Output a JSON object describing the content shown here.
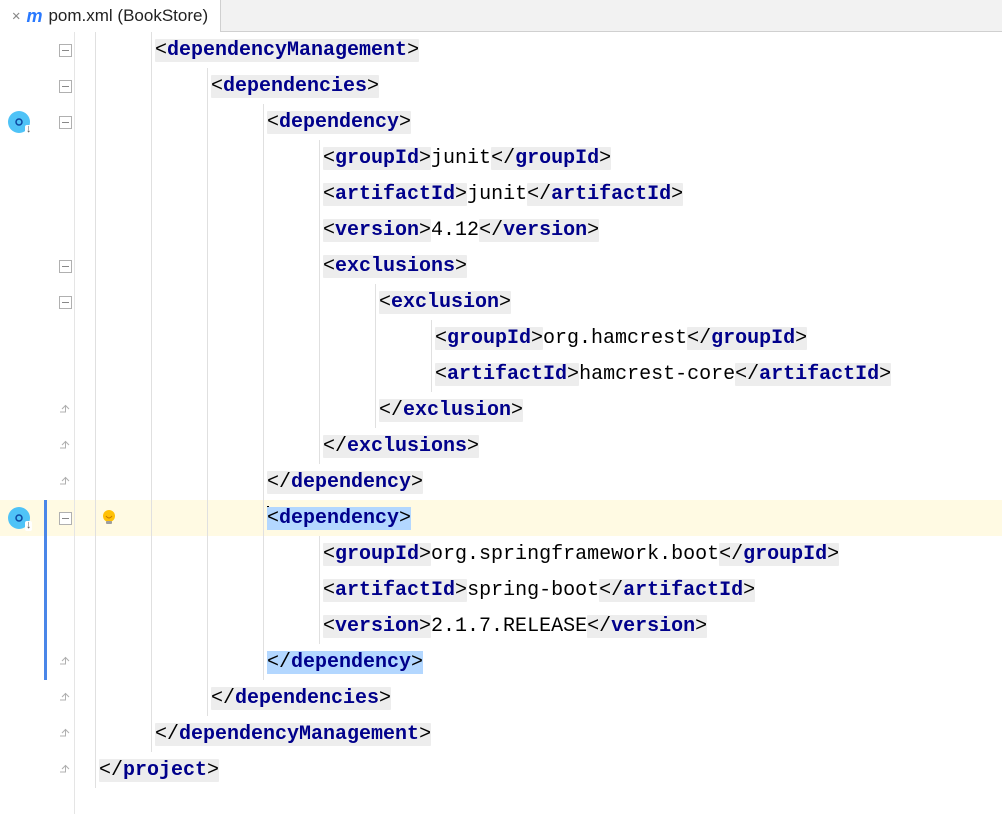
{
  "tab": {
    "label": "pom.xml (BookStore)"
  },
  "lines": [
    {
      "indent": 1,
      "type": "open",
      "bg": "grey",
      "tag": "dependencyManagement",
      "fold": "minus"
    },
    {
      "indent": 2,
      "type": "open",
      "bg": "grey",
      "tag": "dependencies",
      "fold": "minus"
    },
    {
      "indent": 3,
      "type": "open",
      "bg": "grey",
      "tag": "dependency",
      "fold": "minus",
      "override": true
    },
    {
      "indent": 4,
      "type": "leaf",
      "bg": "grey",
      "tag": "groupId",
      "text": "junit"
    },
    {
      "indent": 4,
      "type": "leaf",
      "bg": "grey",
      "tag": "artifactId",
      "text": "junit"
    },
    {
      "indent": 4,
      "type": "leaf",
      "bg": "grey",
      "tag": "version",
      "text": "4.12"
    },
    {
      "indent": 4,
      "type": "open",
      "bg": "grey",
      "tag": "exclusions",
      "fold": "minus"
    },
    {
      "indent": 5,
      "type": "open",
      "bg": "grey",
      "tag": "exclusion",
      "fold": "minus"
    },
    {
      "indent": 6,
      "type": "leaf",
      "bg": "grey",
      "tag": "groupId",
      "text": "org.hamcrest"
    },
    {
      "indent": 6,
      "type": "leaf",
      "bg": "grey",
      "tag": "artifactId",
      "text": "hamcrest-core"
    },
    {
      "indent": 5,
      "type": "close",
      "bg": "grey",
      "tag": "exclusion",
      "fold": "up"
    },
    {
      "indent": 4,
      "type": "close",
      "bg": "grey",
      "tag": "exclusions",
      "fold": "up"
    },
    {
      "indent": 3,
      "type": "close",
      "bg": "grey",
      "tag": "dependency",
      "fold": "up"
    },
    {
      "indent": 3,
      "type": "open",
      "bg": "sel",
      "tag": "dependency",
      "fold": "minus",
      "highlight": true,
      "override": true,
      "change": true,
      "bulb": true,
      "cursor": true
    },
    {
      "indent": 4,
      "type": "leaf",
      "bg": "grey",
      "tag": "groupId",
      "text": "org.springframework.boot",
      "change": true
    },
    {
      "indent": 4,
      "type": "leaf",
      "bg": "grey",
      "tag": "artifactId",
      "text": "spring-boot",
      "change": true
    },
    {
      "indent": 4,
      "type": "leaf",
      "bg": "grey",
      "tag": "version",
      "text": "2.1.7.RELEASE",
      "change": true
    },
    {
      "indent": 3,
      "type": "close",
      "bg": "sel",
      "tag": "dependency",
      "fold": "up",
      "change": true
    },
    {
      "indent": 2,
      "type": "close",
      "bg": "grey",
      "tag": "dependencies",
      "fold": "up"
    },
    {
      "indent": 1,
      "type": "close",
      "bg": "grey",
      "tag": "dependencyManagement",
      "fold": "up"
    },
    {
      "indent": 0,
      "type": "close",
      "bg": "grey",
      "tag": "project",
      "fold": "up"
    }
  ]
}
